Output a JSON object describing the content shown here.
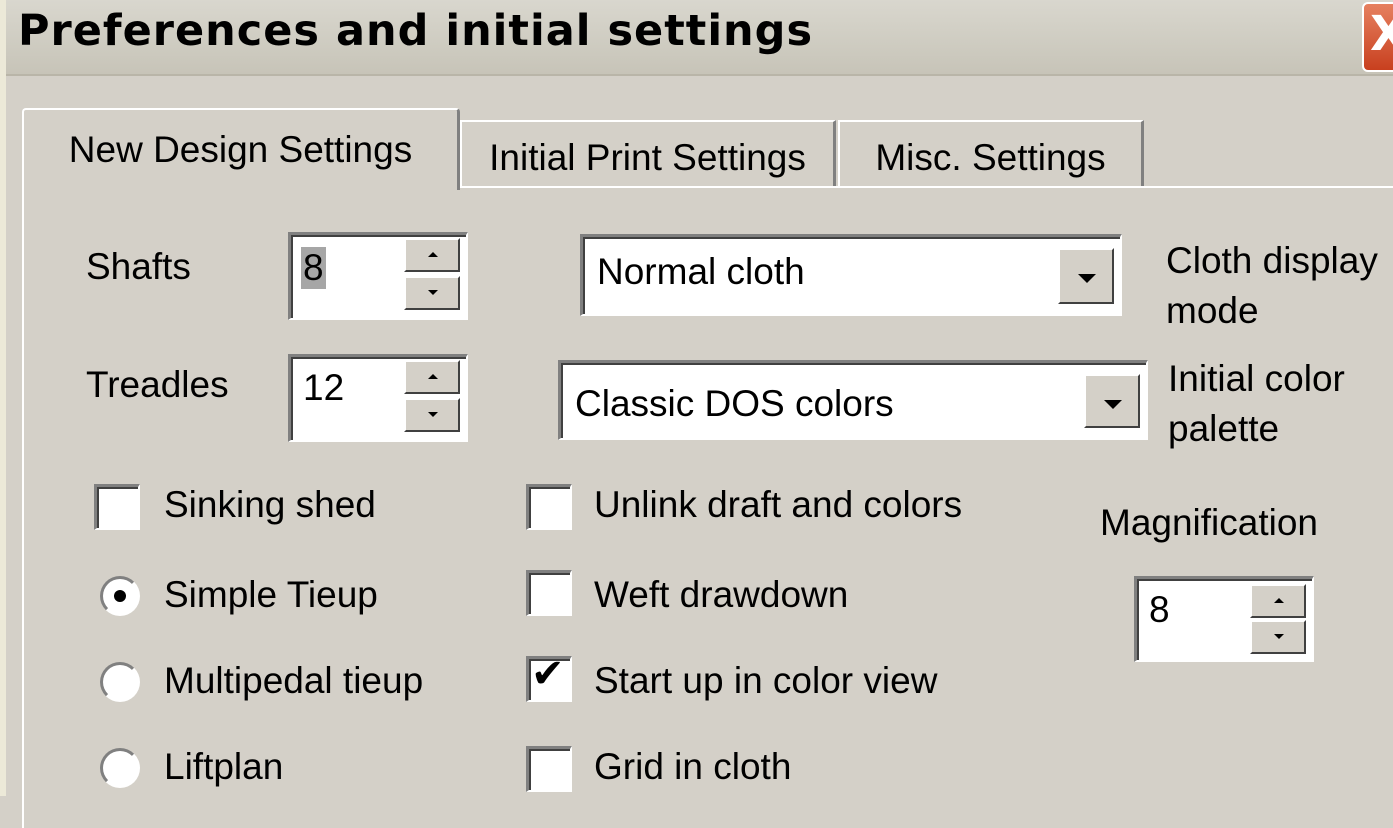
{
  "window": {
    "title": "Preferences and initial settings",
    "close_glyph": "X"
  },
  "tabs": [
    {
      "label": "New Design Settings",
      "active": true
    },
    {
      "label": "Initial Print Settings",
      "active": false
    },
    {
      "label": "Misc. Settings",
      "active": false
    }
  ],
  "shafts": {
    "label": "Shafts",
    "value": "8"
  },
  "treadles": {
    "label": "Treadles",
    "value": "12"
  },
  "cloth_display": {
    "value": "Normal cloth",
    "label_line1": "Cloth display",
    "label_line2": "mode"
  },
  "color_palette": {
    "value": "Classic DOS colors",
    "label_line1": "Initial color",
    "label_line2": "palette"
  },
  "options_left": [
    {
      "label": "Sinking shed",
      "checked": false
    },
    {
      "label": "Simple Tieup",
      "selected": true
    },
    {
      "label": "Multipedal tieup",
      "selected": false
    },
    {
      "label": "Liftplan",
      "selected": false
    }
  ],
  "options_middle": [
    {
      "label": "Unlink draft and colors",
      "checked": false
    },
    {
      "label": "Weft drawdown",
      "checked": false
    },
    {
      "label": "Start up in color view",
      "checked": true
    },
    {
      "label": "Grid in cloth",
      "checked": false
    }
  ],
  "magnification": {
    "label": "Magnification",
    "value": "8"
  },
  "icons": {
    "close": "close-icon",
    "spin_up": "spin-up-icon",
    "spin_down": "spin-down-icon",
    "dropdown": "dropdown-arrow-icon",
    "check": "checkmark-icon"
  }
}
